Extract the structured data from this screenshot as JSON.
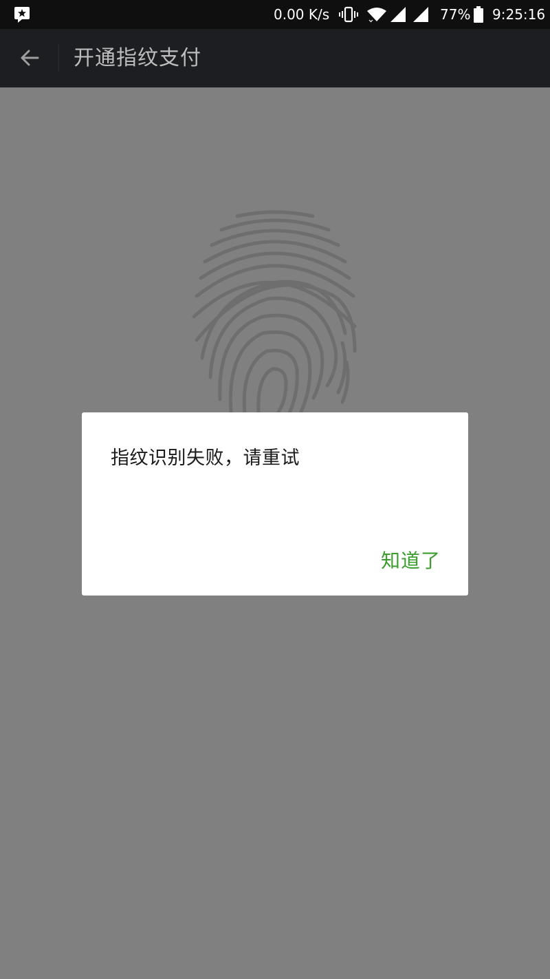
{
  "status_bar": {
    "net_speed": "0.00 K/s",
    "battery_percent": "77%",
    "time": "9:25:16",
    "icons": [
      "app-notification-icon",
      "vibrate-icon",
      "wifi-icon",
      "signal-icon",
      "signal-icon",
      "battery-icon"
    ]
  },
  "toolbar": {
    "back_icon": "arrow-left-icon",
    "title": "开通指纹支付"
  },
  "content": {
    "fingerprint_icon": "fingerprint-icon"
  },
  "dialog": {
    "message": "指纹识别失败，请重试",
    "confirm_label": "知道了"
  },
  "colors": {
    "status_bar_bg": "#0f0f0f",
    "toolbar_bg": "#1d1e21",
    "scrim": "#808080",
    "fingerprint": "#6e6e6e",
    "dialog_bg": "#ffffff",
    "accent_green": "#3a9d2c"
  }
}
